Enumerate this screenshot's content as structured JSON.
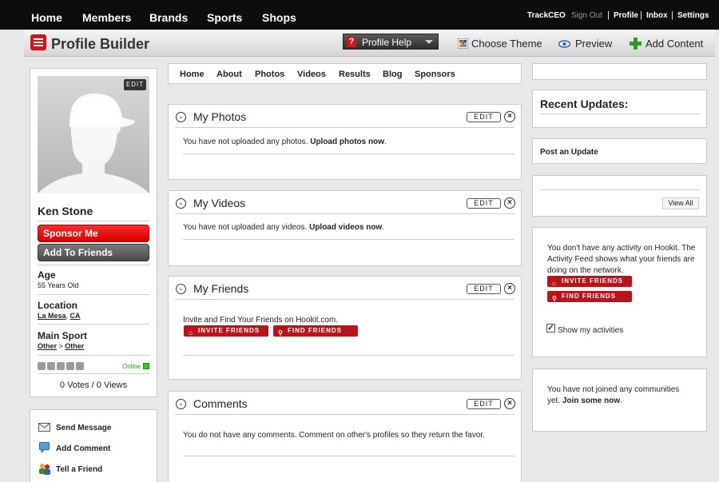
{
  "topnav": {
    "items": [
      "Home",
      "Members",
      "Brands",
      "Sports",
      "Shops"
    ],
    "user": "TrackCEO",
    "signout": "Sign Out",
    "profile": "Profile",
    "inbox": "Inbox",
    "settings": "Settings",
    "separator": "|"
  },
  "builder": {
    "title": "Profile Builder",
    "help_icon": "?",
    "help": "Profile Help",
    "choose_theme": "Choose Theme",
    "preview": "Preview",
    "add_content": "Add Content"
  },
  "profile": {
    "avatar_edit": "EDIT",
    "name": "Ken Stone",
    "sponsor": "Sponsor Me",
    "add_friends": "Add To Friends",
    "age_label": "Age",
    "age_value": "55 Years Old",
    "location_label": "Location",
    "location_city": "La Mesa",
    "location_sep": ", ",
    "location_state": "CA",
    "sport_label": "Main Sport",
    "sport_a": "Other",
    "sport_sep": " > ",
    "sport_b": "Other",
    "rating": 0,
    "online": "Online",
    "votes": "0 Votes / 0 Views"
  },
  "actions": {
    "send_message": "Send Message",
    "add_comment": "Add Comment",
    "tell_friend": "Tell a Friend"
  },
  "subnav": [
    "Home",
    "About",
    "Photos",
    "Videos",
    "Results",
    "Blog",
    "Sponsors"
  ],
  "panels": {
    "collapse_icon": "⌄",
    "edit": "EDIT",
    "close": "×",
    "photos": {
      "title": "My Photos",
      "text": "You have not uploaded any photos. ",
      "link": "Upload photos now",
      "end": "."
    },
    "videos": {
      "title": "My Videos",
      "text": "You have not uploaded any videos. ",
      "link": "Upload videos now",
      "end": "."
    },
    "friends": {
      "title": "My Friends",
      "text": "Invite and Find Your Friends on Hookit.com.",
      "invite": "INVITE FRIENDS",
      "find": "FIND FRIENDS"
    },
    "comments": {
      "title": "Comments",
      "text": "You do not have any comments. Comment on other's profiles so they return the favor."
    }
  },
  "right": {
    "recent_updates": "Recent Updates:",
    "post_update": "Post an Update",
    "view_all": "View All",
    "activity_text": "You don't have any activity on Hookit. The Activity Feed shows what your friends are doing on the network.",
    "invite": "INVITE FRIENDS",
    "find": "FIND FRIENDS",
    "show_activities": "Show my activities",
    "show_activities_checked": true,
    "communities_text": "You have not joined any communities yet. ",
    "communities_link": "Join some now",
    "communities_end": "."
  },
  "colors": {
    "brand_red": "#d2151c",
    "button_red": "#b81419",
    "online_green": "#3bbf2a"
  }
}
